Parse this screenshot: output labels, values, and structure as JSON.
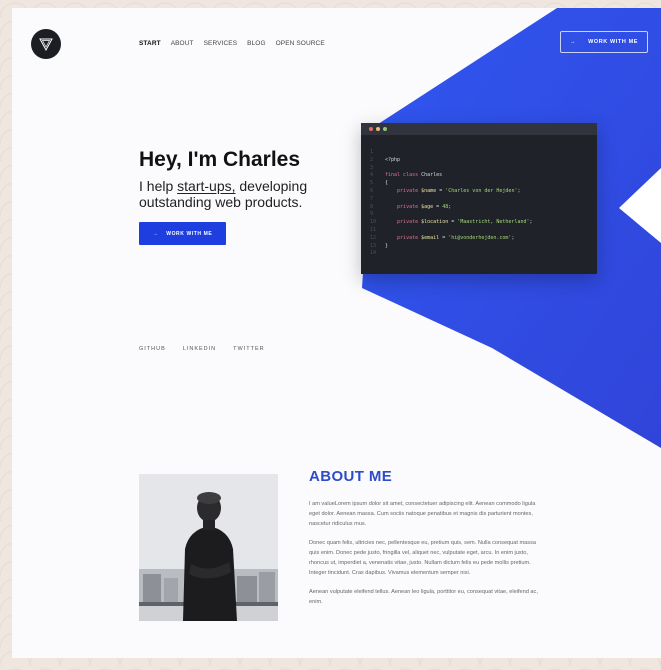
{
  "nav": {
    "items": [
      {
        "label": "START",
        "active": true
      },
      {
        "label": "ABOUT",
        "active": false
      },
      {
        "label": "SERVICES",
        "active": false
      },
      {
        "label": "BLOG",
        "active": false
      },
      {
        "label": "OPEN SOURCE",
        "active": false
      }
    ],
    "cta_arrow": "→",
    "cta_label": "WORK WITH ME"
  },
  "hero": {
    "greeting": "Hey,",
    "name": "I'm Charles",
    "sub_prefix": "I help ",
    "sub_link": "start-ups,",
    "sub_suffix": " developing outstanding web products.",
    "button_arrow": "→",
    "button_label": "WORK WITH ME"
  },
  "editor": {
    "dots": [
      "#e06c75",
      "#e5c07b",
      "#98c379"
    ],
    "lines": [
      {
        "n": "1",
        "parts": []
      },
      {
        "n": "2",
        "parts": [
          {
            "t": "<?php",
            "c": "txt"
          }
        ]
      },
      {
        "n": "3",
        "parts": []
      },
      {
        "n": "4",
        "parts": [
          {
            "t": "final class ",
            "c": "kw"
          },
          {
            "t": "Charles",
            "c": "txt"
          }
        ]
      },
      {
        "n": "5",
        "parts": [
          {
            "t": "{",
            "c": "txt"
          }
        ]
      },
      {
        "n": "6",
        "parts": [
          {
            "t": "    private ",
            "c": "kw"
          },
          {
            "t": "$name",
            "c": "var"
          },
          {
            "t": " = ",
            "c": "txt"
          },
          {
            "t": "'Charles von der Hejden'",
            "c": "str"
          },
          {
            "t": ";",
            "c": "txt"
          }
        ]
      },
      {
        "n": "7",
        "parts": []
      },
      {
        "n": "8",
        "parts": [
          {
            "t": "    private ",
            "c": "kw"
          },
          {
            "t": "$age",
            "c": "var"
          },
          {
            "t": " = ",
            "c": "txt"
          },
          {
            "t": "48",
            "c": "str"
          },
          {
            "t": ";",
            "c": "txt"
          }
        ]
      },
      {
        "n": "9",
        "parts": []
      },
      {
        "n": "10",
        "parts": [
          {
            "t": "    private ",
            "c": "kw"
          },
          {
            "t": "$location",
            "c": "var"
          },
          {
            "t": " = ",
            "c": "txt"
          },
          {
            "t": "'Maastricht, Netherland'",
            "c": "str"
          },
          {
            "t": ";",
            "c": "txt"
          }
        ]
      },
      {
        "n": "11",
        "parts": []
      },
      {
        "n": "12",
        "parts": [
          {
            "t": "    private ",
            "c": "kw"
          },
          {
            "t": "$email",
            "c": "var"
          },
          {
            "t": " = ",
            "c": "txt"
          },
          {
            "t": "'hi@vonderhejden.com'",
            "c": "str"
          },
          {
            "t": ";",
            "c": "txt"
          }
        ]
      },
      {
        "n": "13",
        "parts": [
          {
            "t": "}",
            "c": "txt"
          }
        ]
      },
      {
        "n": "14",
        "parts": []
      }
    ]
  },
  "social": [
    "GITHUB",
    "LINKEDIN",
    "TWITTER"
  ],
  "about": {
    "title": "ABOUT ME",
    "paragraphs": [
      "I am valueLorem ipsum dolor sit amet, consectetuer adipiscing elit. Aenean commodo ligula eget dolor. Aenean massa. Cum sociis natoque penatibus et magnis dis parturient montes, nascetur ridiculus mus.",
      "Donec quam felis, ultricies nec, pellentesque eu, pretium quis, sem. Nulla consequat massa quis enim. Donec pede justo, fringilla vel, aliquet nec, vulputate eget, arcu. In enim justo, rhoncus ut, imperdiet a, venenatis vitae, justo. Nullam dictum felis eu pede mollis pretium. Integer tincidunt. Cras dapibus. Vivamus elementum semper nisi.",
      "Aenean vulputate eleifend tellus. Aenean leo ligula, porttitor eu, consequat vitae, eleifend ac, enim."
    ]
  },
  "colors": {
    "accent": "#1f3ee0",
    "about_title": "#2f4bc9",
    "editor_bg": "#1f2229"
  }
}
